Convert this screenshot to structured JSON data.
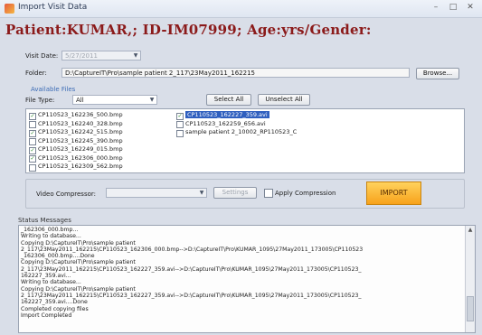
{
  "window": {
    "title": "Import Visit Data",
    "minimize": "–",
    "maximize": "□",
    "close": "✕"
  },
  "header": {
    "patient_line": "Patient:KUMAR,; ID-IM07999; Age:yrs/Gender:"
  },
  "visit": {
    "label": "Visit Date:",
    "value": "5/27/2011"
  },
  "folder": {
    "label": "Folder:",
    "value": "D:\\CaptureIT\\Pro\\sample patient 2_117\\23May2011_162215",
    "browse_label": "Browse..."
  },
  "files": {
    "group_title": "Available Files",
    "file_type_label": "File Type:",
    "file_type_value": "All",
    "select_all_label": "Select All",
    "unselect_all_label": "Unselect All",
    "left_list": [
      {
        "name": "CP110523_162236_500.bmp",
        "checked": true
      },
      {
        "name": "CP110523_162240_328.bmp",
        "checked": false
      },
      {
        "name": "CP110523_162242_515.bmp",
        "checked": true
      },
      {
        "name": "CP110523_162245_390.bmp",
        "checked": false
      },
      {
        "name": "CP110523_162249_015.bmp",
        "checked": true
      },
      {
        "name": "CP110523_162306_000.bmp",
        "checked": true
      },
      {
        "name": "CP110523_162309_562.bmp",
        "checked": false
      }
    ],
    "right_list": [
      {
        "name": "CP110523_162227_359.avi",
        "checked": true,
        "selected": true
      },
      {
        "name": "CP110523_162259_656.avi",
        "checked": false
      },
      {
        "name": "sample patient 2_10002_RP110523_C",
        "checked": false
      }
    ]
  },
  "video": {
    "compressor_label": "Video Compressor:",
    "compressor_value": "",
    "settings_label": "Settings",
    "apply_label": "Apply Compression",
    "import_label": "IMPORT"
  },
  "status": {
    "label": "Status Messages",
    "lines": [
      "_162306_000.bmp...",
      "Writing to database...",
      "Copying D:\\CaptureIT\\Pro\\sample patient",
      "2_117\\23May2011_162215\\CP110523_162306_000.bmp-->D:\\CaptureIT\\Pro\\KUMAR_1095\\27May2011_173005\\CP110523",
      "_162306_000.bmp....Done",
      "Copying D:\\CaptureIT\\Pro\\sample patient",
      "2_117\\23May2011_162215\\CP110523_162227_359.avi-->D:\\CaptureIT\\Pro\\KUMAR_1095\\27May2011_173005\\CP110523_",
      "162227_359.avi...",
      "Writing to database...",
      "Copying D:\\CaptureIT\\Pro\\sample patient",
      "2_117\\23May2011_162215\\CP110523_162227_359.avi-->D:\\CaptureIT\\Pro\\KUMAR_1095\\27May2011_173005\\CP110523_",
      "162227_359.avi....Done",
      "Completed copying files",
      "Import Completed"
    ]
  },
  "colors": {
    "accent_title": "#8b1a1a",
    "group_title": "#3b6bb5",
    "selection": "#2f5fbf",
    "import_button": "#f7a21b"
  }
}
